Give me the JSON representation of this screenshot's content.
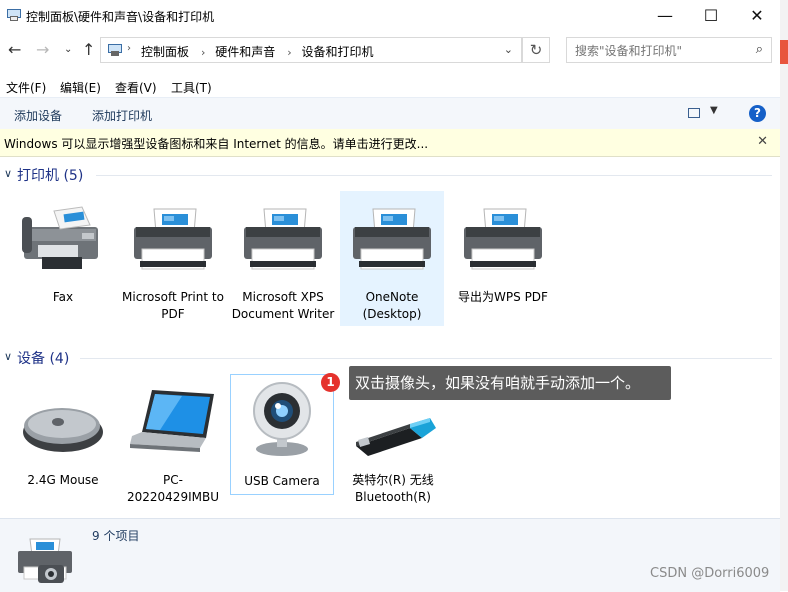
{
  "window": {
    "title": "控制面板\\硬件和声音\\设备和打印机",
    "minimize_glyph": "—",
    "maximize_glyph": "☐",
    "close_glyph": "✕"
  },
  "address": {
    "crumbs": [
      "控制面板",
      "硬件和声音",
      "设备和打印机"
    ],
    "search_placeholder": "搜索\"设备和打印机\""
  },
  "menu": [
    "文件(F)",
    "编辑(E)",
    "查看(V)",
    "工具(T)"
  ],
  "commands": {
    "add_device": "添加设备",
    "add_printer": "添加打印机",
    "help": "?"
  },
  "infobar": {
    "text": "Windows 可以显示增强型设备图标和来自 Internet 的信息。请单击进行更改...",
    "close": "✕"
  },
  "printers": {
    "header": "打印机 (5)",
    "items": [
      {
        "name": "Fax",
        "icon": "fax-icon"
      },
      {
        "name": "Microsoft Print to PDF",
        "icon": "printer-icon"
      },
      {
        "name": "Microsoft XPS Document Writer",
        "icon": "printer-icon"
      },
      {
        "name": "OneNote (Desktop)",
        "icon": "printer-icon",
        "selected": true
      },
      {
        "name": "导出为WPS PDF",
        "icon": "printer-icon"
      }
    ]
  },
  "devices": {
    "header": "设备 (4)",
    "items": [
      {
        "name": "2.4G Mouse",
        "icon": "mouse-icon"
      },
      {
        "name": "PC-20220429IMBU",
        "icon": "laptop-icon"
      },
      {
        "name": "USB Camera",
        "icon": "webcam-icon",
        "focused": true
      },
      {
        "name": "英特尔(R) 无线 Bluetooth(R)",
        "icon": "bluetooth-dongle-icon"
      }
    ]
  },
  "tooltip": {
    "badge": "1",
    "text": "双击摄像头，如果没有咱就手动添加一个。"
  },
  "details": {
    "count": "9 个项目"
  },
  "watermark": "CSDN @Dorri6009",
  "colors": {
    "selection": "#e5f3ff",
    "group_header": "#1e3287",
    "tooltip_bg": "#5c5c5c",
    "badge": "#e5322d"
  }
}
